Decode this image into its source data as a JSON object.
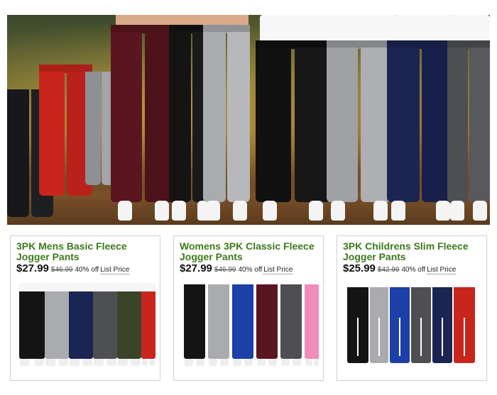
{
  "hero": {
    "image_alt": "Jogger pants in multiple colors"
  },
  "colors": {
    "title_green": "#3d7a1a",
    "burgundy": "#5a1620",
    "black": "#141414",
    "light_gray": "#a9abae",
    "navy": "#1b2553",
    "charcoal": "#4d4f52",
    "red": "#c8261c",
    "olive": "#3a4428",
    "royal_blue": "#1c3fa8",
    "pink": "#f08cb9"
  },
  "products": [
    {
      "title": "3PK Mens Basic Fleece Jogger Pants",
      "price": "$27.99",
      "list_price": "$46.99",
      "discount": "40% off",
      "list_label": "List Price"
    },
    {
      "title": "Womens 3PK Classic Fleece Jogger Pants",
      "price": "$27.99",
      "list_price": "$46.99",
      "discount": "40% off",
      "list_label": "List Price"
    },
    {
      "title": "3PK Childrens Slim Fleece Jogger Pants",
      "price": "$25.99",
      "list_price": "$42.99",
      "discount": "40% off",
      "list_label": "List Price"
    }
  ]
}
